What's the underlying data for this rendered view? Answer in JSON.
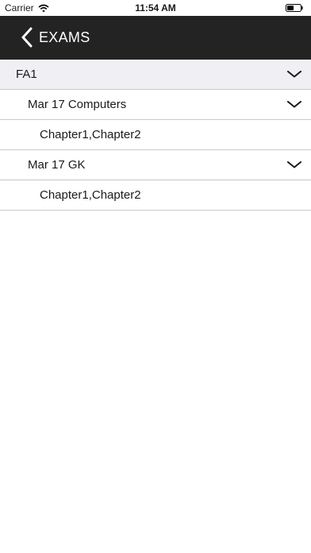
{
  "status_bar": {
    "carrier": "Carrier",
    "time": "11:54 AM"
  },
  "nav": {
    "title": "EXAMS"
  },
  "list": {
    "group": {
      "label": "FA1"
    },
    "exams": [
      {
        "label": "Mar 17 Computers",
        "detail": "Chapter1,Chapter2"
      },
      {
        "label": "Mar 17 GK",
        "detail": "Chapter1,Chapter2"
      }
    ]
  },
  "colors": {
    "nav_background": "#232323",
    "group_background": "#efeff4",
    "separator": "#c8c8cc"
  }
}
